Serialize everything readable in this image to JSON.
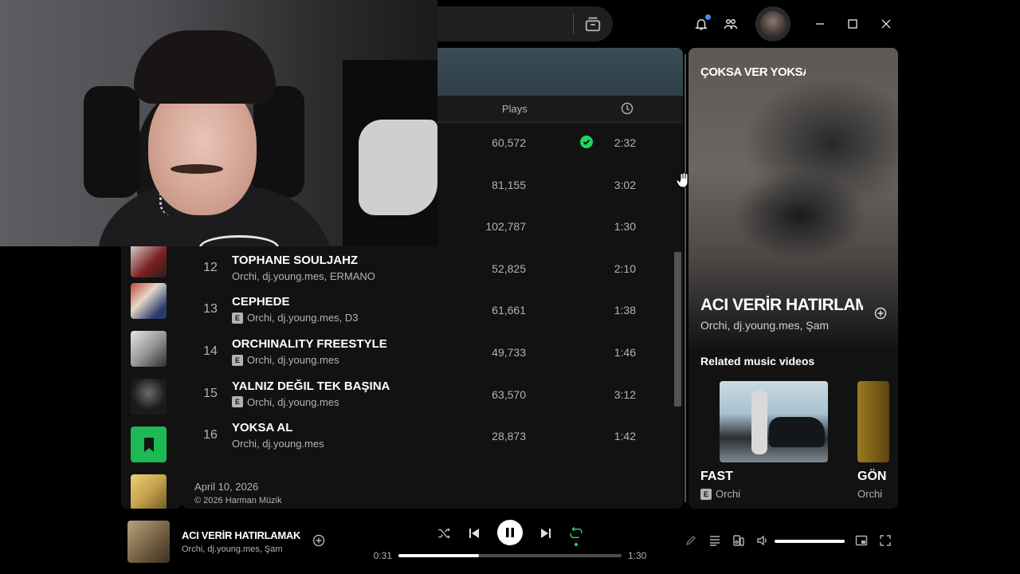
{
  "titlebar": {
    "icons": [
      "browse-icon",
      "bell-icon",
      "friends-icon",
      "minimize-icon",
      "maximize-icon",
      "close-icon"
    ],
    "has_notification": true
  },
  "library": {
    "items": [
      "album-cover",
      "album-cover",
      "album-cover",
      "album-cover",
      "bookmark-icon",
      "album-cover"
    ],
    "accent": "#1db954"
  },
  "tracklist": {
    "columns": {
      "plays": "Plays",
      "duration_icon": "clock-icon"
    },
    "rows": [
      {
        "num": "",
        "title": "",
        "artist": "",
        "explicit": false,
        "plays": "60,572",
        "saved": true,
        "duration": "2:32"
      },
      {
        "num": "",
        "title": "",
        "artist": "",
        "explicit": false,
        "plays": "81,155",
        "saved": false,
        "duration": "3:02"
      },
      {
        "num": "",
        "title": "",
        "artist": "",
        "explicit": false,
        "plays": "102,787",
        "saved": false,
        "duration": "1:30"
      },
      {
        "num": "12",
        "title": "TOPHANE SOULJAHZ",
        "artist": "Orchi, dj.young.mes, ERMANO",
        "explicit": false,
        "plays": "52,825",
        "saved": false,
        "duration": "2:10"
      },
      {
        "num": "13",
        "title": "CEPHEDE",
        "artist": "Orchi, dj.young.mes, D3",
        "explicit": true,
        "plays": "61,661",
        "saved": false,
        "duration": "1:38"
      },
      {
        "num": "14",
        "title": "ORCHINALITY FREESTYLE",
        "artist": "Orchi, dj.young.mes",
        "explicit": true,
        "plays": "49,733",
        "saved": false,
        "duration": "1:46"
      },
      {
        "num": "15",
        "title": "YALNIZ DEĞIL TEK BAŞINA",
        "artist": "Orchi, dj.young.mes",
        "explicit": true,
        "plays": "63,570",
        "saved": false,
        "duration": "3:12"
      },
      {
        "num": "16",
        "title": "YOKSA AL",
        "artist": "Orchi, dj.young.mes",
        "explicit": false,
        "plays": "28,873",
        "saved": false,
        "duration": "1:42"
      }
    ],
    "release_date": "April 10, 2026",
    "copyright": "© 2026 Harman Müzik",
    "explicit_badge": "E",
    "saved_color": "#1ed760"
  },
  "now_playing_panel": {
    "context": "ÇOKSA VER YOKSA AL",
    "title": "ACI VERİR HATIRLAMAK",
    "artist": "Orchi, dj.young.mes, Şam",
    "related_heading": "Related music videos",
    "videos": [
      {
        "title": "FAST",
        "artist": "Orchi",
        "explicit": true
      },
      {
        "title": "GÖN",
        "artist": "Orchi",
        "explicit": false
      }
    ]
  },
  "player": {
    "title": "ACI VERİR HATIRLAMAK",
    "artist": "Orchi, dj.young.mes, Şam",
    "elapsed": "0:31",
    "total": "1:30",
    "progress": 0.36,
    "volume": 1.0,
    "is_playing": true,
    "repeat_active": true,
    "controls": [
      "shuffle-icon",
      "previous-icon",
      "pause-icon",
      "next-icon",
      "repeat-icon"
    ],
    "right_controls": [
      "lyrics-icon",
      "queue-icon",
      "connect-device-icon",
      "volume-icon",
      "miniplayer-icon",
      "fullscreen-icon"
    ]
  }
}
